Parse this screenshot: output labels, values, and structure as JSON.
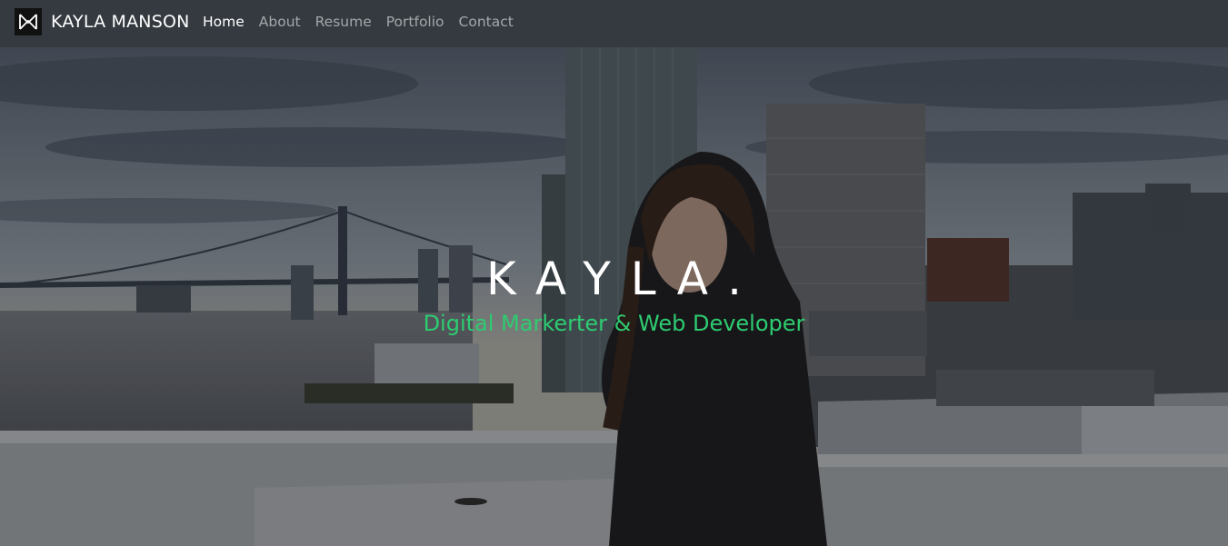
{
  "brand": {
    "name": "KAYLA MANSON",
    "logo_icon": "km-monogram-icon"
  },
  "nav": {
    "items": [
      {
        "label": "Home",
        "active": true
      },
      {
        "label": "About",
        "active": false
      },
      {
        "label": "Resume",
        "active": false
      },
      {
        "label": "Portfolio",
        "active": false
      },
      {
        "label": "Contact",
        "active": false
      }
    ]
  },
  "hero": {
    "title": "KAYLA.",
    "subtitle": "Digital Markerter & Web Developer",
    "background": "rooftop-city-skyline-photo"
  },
  "colors": {
    "navbar_bg": "#343a40",
    "accent": "#2ecc71",
    "text": "#ffffff"
  }
}
